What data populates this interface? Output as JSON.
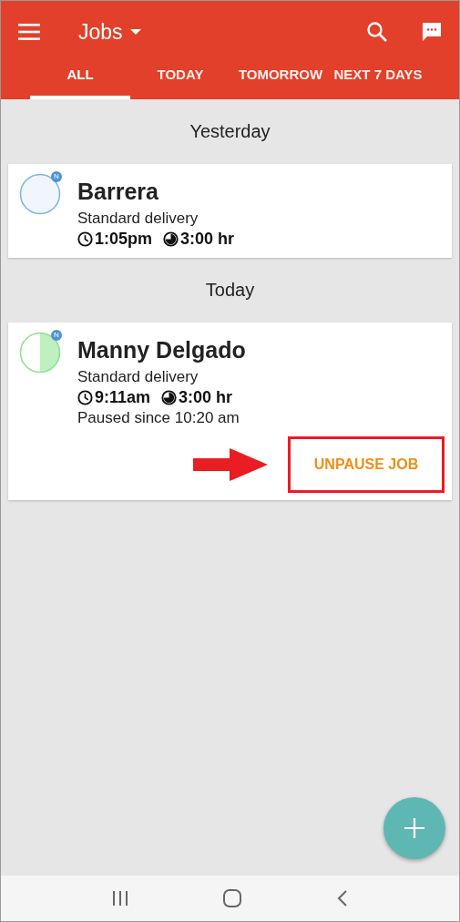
{
  "app_bar": {
    "title": "Jobs"
  },
  "tabs": [
    {
      "label": "ALL",
      "selected": true
    },
    {
      "label": "TODAY",
      "selected": false
    },
    {
      "label": "TOMORROW",
      "selected": false
    },
    {
      "label": "NEXT 7 DAYS",
      "selected": false
    }
  ],
  "sections": [
    {
      "heading": "Yesterday",
      "jobs": [
        {
          "name": "Barrera",
          "badge": "N",
          "started": false,
          "type": "Standard delivery",
          "time": "1:05pm",
          "duration": "3:00 hr"
        }
      ]
    },
    {
      "heading": "Today",
      "jobs": [
        {
          "name": "Manny Delgado",
          "badge": "N",
          "started": true,
          "type": "Standard delivery",
          "time": "9:11am",
          "duration": "3:00 hr",
          "status": "Paused since 10:20 am",
          "action": {
            "label": "UNPAUSE JOB",
            "highlighted": true
          }
        }
      ]
    }
  ]
}
